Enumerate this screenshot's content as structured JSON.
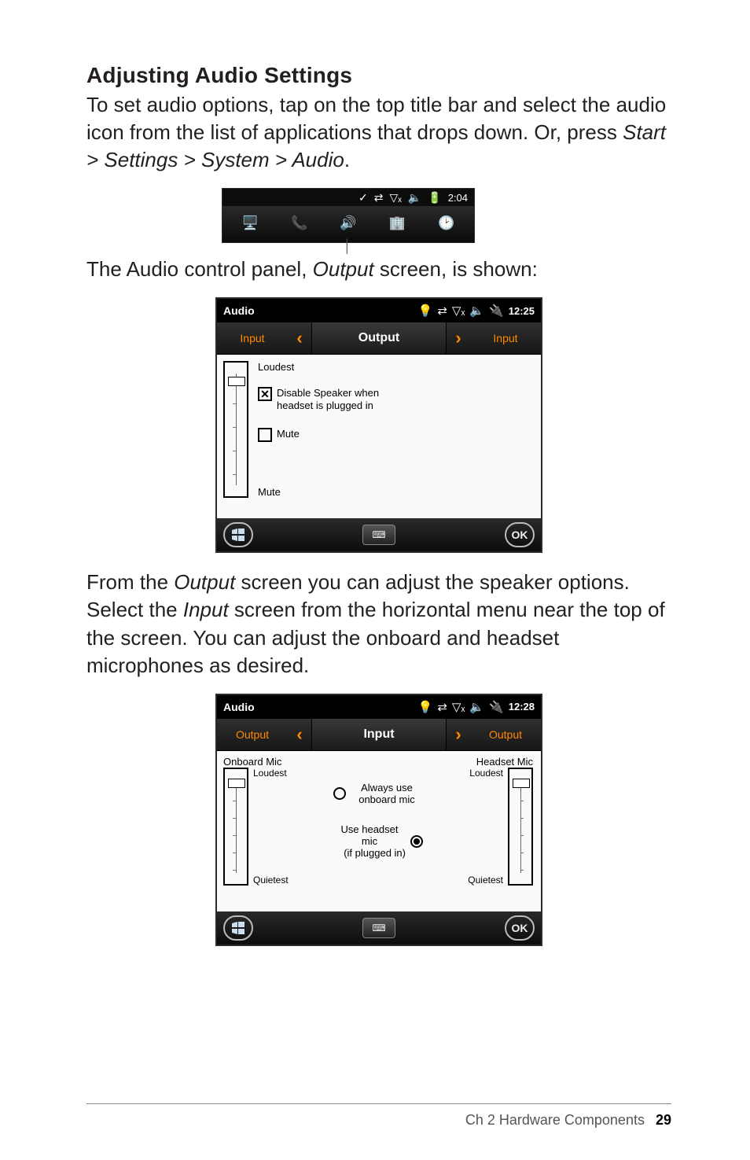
{
  "heading": "Adjusting Audio Settings",
  "para1_pre": "To set audio options, tap on the top title bar and select the audio icon from the list of applications that drops down. Or, press ",
  "para1_italic": "Start > Settings > System > Audio",
  "para1_post": ".",
  "minibar": {
    "time": "2:04",
    "icons": [
      "✓",
      "⇄",
      "▽ₓ",
      "🔈",
      "🔋"
    ]
  },
  "para2_pre": "The Audio control panel, ",
  "para2_italic": "Output",
  "para2_post": " screen, is shown:",
  "output_shot": {
    "title": "Audio",
    "time": "12:25",
    "status_icons": [
      "💡",
      "⇄",
      "▽ₓ",
      "🔈",
      "🔌"
    ],
    "tab_left": "Input",
    "tab_active": "Output",
    "tab_right": "Input",
    "loudest": "Loudest",
    "option1_line1": "Disable Speaker when",
    "option1_line2": "headset is plugged in",
    "option2": "Mute",
    "bottom_mute": "Mute",
    "option1_checked": true,
    "option2_checked": false,
    "ok": "OK"
  },
  "para3_pre": "From the ",
  "para3_i1": "Output",
  "para3_mid": " screen you can adjust the speaker options. Select the ",
  "para3_i2": "Input",
  "para3_post": " screen from the horizontal menu near the top of the screen. You can adjust the onboard and headset microphones as desired.",
  "input_shot": {
    "title": "Audio",
    "time": "12:28",
    "status_icons": [
      "💡",
      "⇄",
      "▽ₓ",
      "🔈",
      "🔌"
    ],
    "tab_left": "Output",
    "tab_active": "Input",
    "tab_right": "Output",
    "onboard_mic": "Onboard Mic",
    "headset_mic": "Headset Mic",
    "loudest": "Loudest",
    "quietest": "Quietest",
    "radio1": "Always use onboard mic",
    "radio2_line1": "Use headset mic",
    "radio2_line2": "(if plugged in)",
    "radio_selected": 2,
    "ok": "OK"
  },
  "footer": {
    "text": "Ch 2   Hardware Components",
    "page": "29"
  }
}
